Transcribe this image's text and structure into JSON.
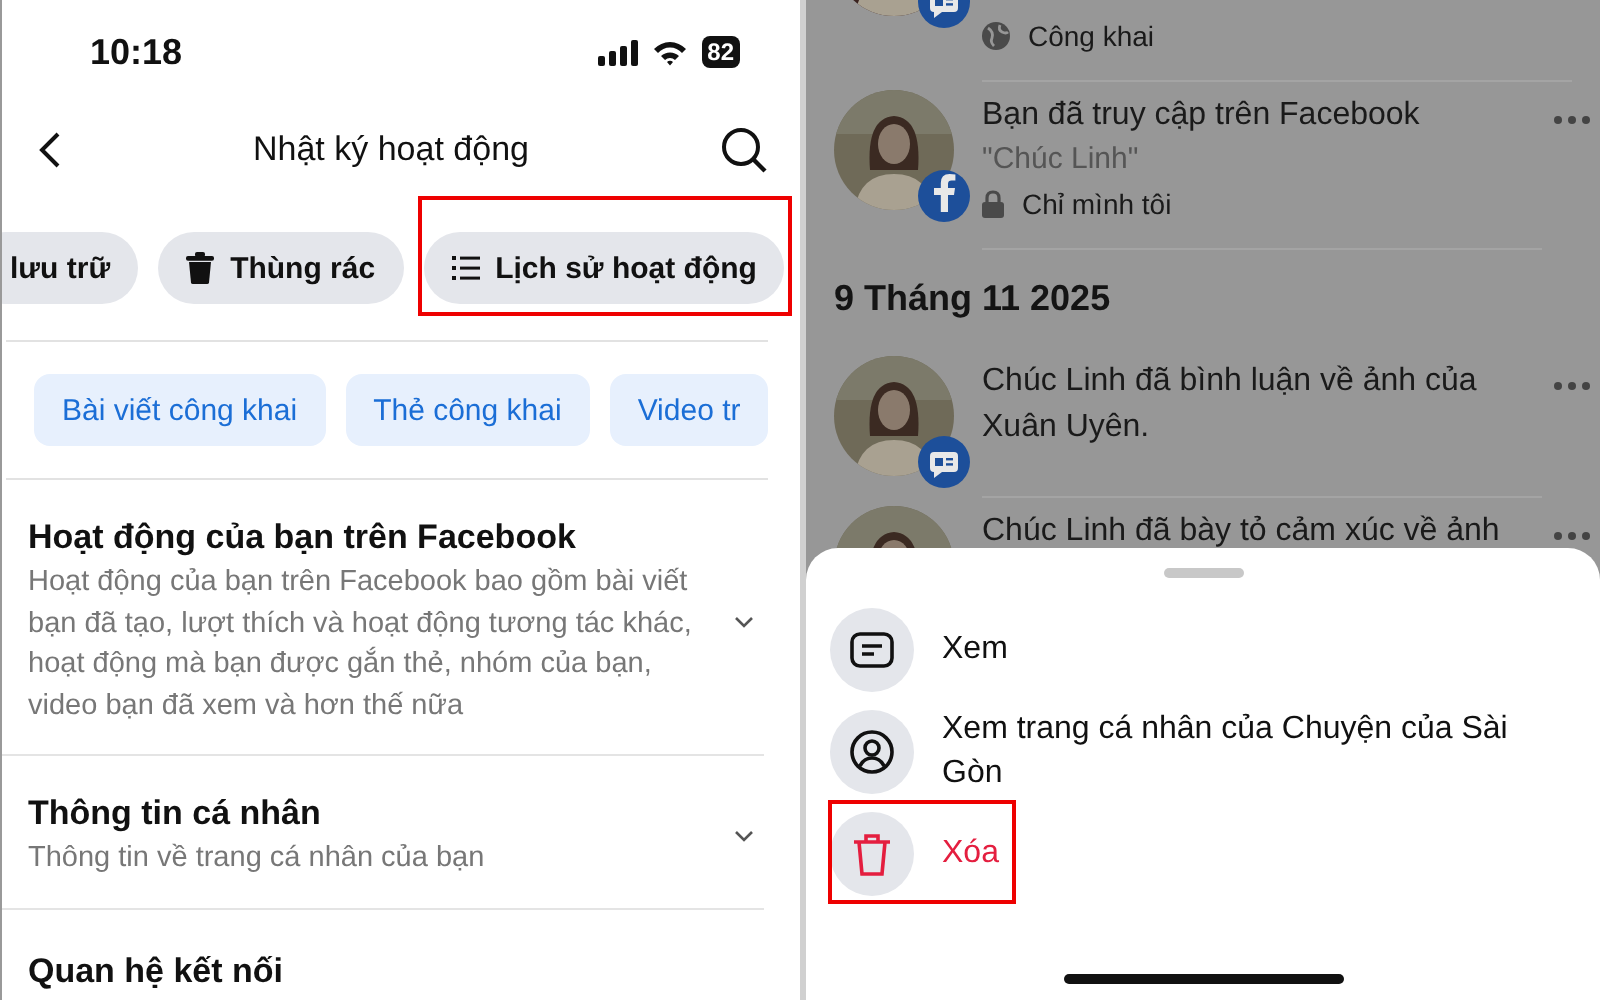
{
  "left": {
    "status_bar": {
      "time": "10:18",
      "battery": "82"
    },
    "header": {
      "title": "Nhật ký hoạt động"
    },
    "chips": [
      {
        "label": "lưu trữ",
        "kind": "cut"
      },
      {
        "label": "Thùng rác",
        "kind": "trash"
      },
      {
        "label": "Lịch sử hoạt động",
        "kind": "list",
        "highlighted": true
      }
    ],
    "filters": [
      {
        "label": "Bài viết công khai"
      },
      {
        "label": "Thẻ công khai"
      },
      {
        "label": "Video tr"
      }
    ],
    "sections": [
      {
        "title": "Hoạt động của bạn trên Facebook",
        "description": "Hoạt động của bạn trên Facebook bao gồm bài viết bạn đã tạo, lượt thích và hoạt động tương tác khác, hoạt động mà bạn được gắn thẻ, nhóm của bạn, video bạn đã xem và hơn thế nữa",
        "expandable": true
      },
      {
        "title": "Thông tin cá nhân",
        "description": "Thông tin về trang cá nhân của bạn",
        "expandable": true
      },
      {
        "title": "Quan hệ kết nối",
        "expandable": false
      }
    ]
  },
  "right": {
    "feed": [
      {
        "kind": "post",
        "badge": {
          "kind": "comment"
        },
        "privacy": {
          "kind": "globe",
          "label": "Công khai"
        }
      },
      {
        "kind": "post",
        "text": "Bạn đã truy cập trên Facebook",
        "quote": "\"Chúc Linh\"",
        "badge": {
          "kind": "facebook"
        },
        "privacy": {
          "kind": "lock",
          "label": "Chỉ mình tôi"
        },
        "menu": true
      },
      {
        "kind": "date",
        "text": "9 Tháng 11 2025"
      },
      {
        "kind": "post",
        "text": "Chúc Linh đã bình luận về ảnh của Xuân Uyên.",
        "badge": {
          "kind": "comment"
        },
        "menu": true
      },
      {
        "kind": "post",
        "text": "Chúc Linh đã bày tỏ cảm xúc về ảnh",
        "menu": true
      }
    ],
    "sheet": {
      "items": [
        {
          "label": "Xem",
          "kind": "view",
          "danger": false
        },
        {
          "label": "Xem trang cá nhân của Chuyện của Sài Gòn",
          "kind": "profile",
          "danger": false
        },
        {
          "label": "Xóa",
          "kind": "delete",
          "danger": true,
          "highlighted": true
        }
      ]
    }
  }
}
